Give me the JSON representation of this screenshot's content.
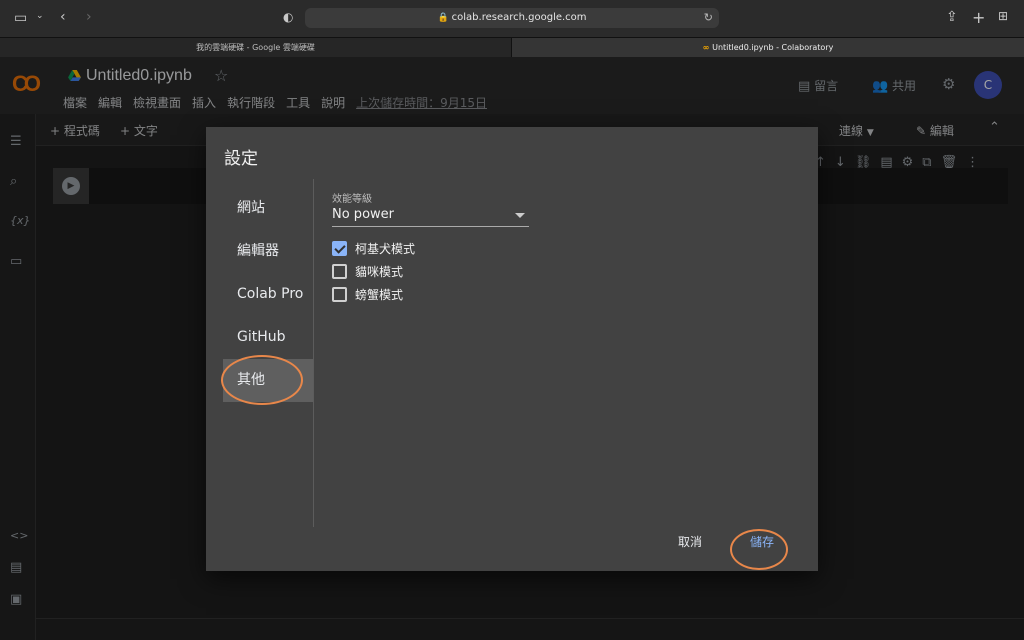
{
  "browser": {
    "url": "colab.research.google.com",
    "tabs": [
      {
        "label": "我的雲端硬碟 - Google 雲端硬碟"
      },
      {
        "label": "Untitled0.ipynb - Colaboratory"
      }
    ]
  },
  "header": {
    "logo": "CO",
    "notebook_title": "Untitled0.ipynb",
    "menu": [
      "檔案",
      "編輯",
      "檢視畫面",
      "插入",
      "執行階段",
      "工具",
      "說明"
    ],
    "last_saved": "上次儲存時間：9月15日",
    "comment_label": "留言",
    "share_label": "共用",
    "avatar_letter": "C"
  },
  "toolbar": {
    "add_code": "+ 程式碼",
    "add_text": "+ 文字",
    "connect": "連線",
    "edit": "編輯"
  },
  "dialog": {
    "title": "設定",
    "nav": [
      "網站",
      "編輯器",
      "Colab Pro",
      "GitHub",
      "其他"
    ],
    "active_nav": "其他",
    "field_label": "效能等級",
    "select_value": "No power",
    "checkboxes": [
      {
        "label": "柯基犬模式",
        "checked": true
      },
      {
        "label": "貓咪模式",
        "checked": false
      },
      {
        "label": "螃蟹模式",
        "checked": false
      }
    ],
    "cancel_label": "取消",
    "save_label": "儲存"
  },
  "colors": {
    "accent": "#8ab4f8",
    "annotation": "#e8874a",
    "logo": "#f9ab00"
  }
}
